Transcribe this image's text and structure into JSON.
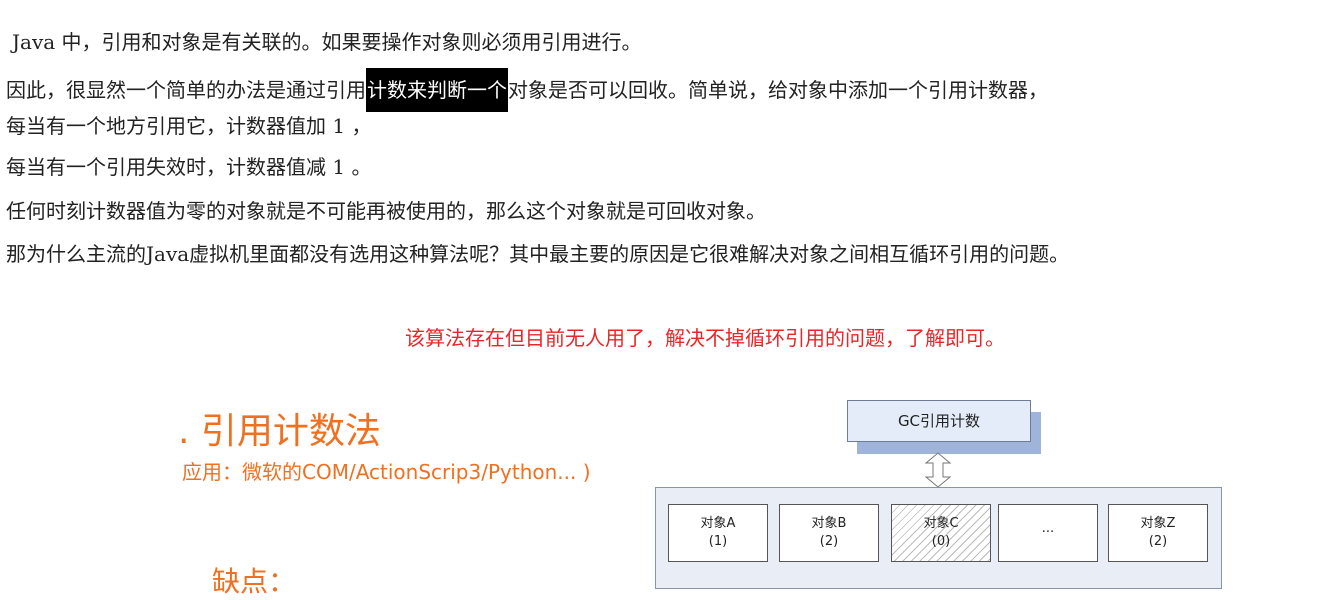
{
  "paragraphs": {
    "l1": "Java 中，引用和对象是有关联的。如果要操作对象则必须用引用进行。",
    "l2a": "因此，很显然一个简单的办法是通过引用",
    "l2_highlight": "计数来判断一个",
    "l2b": "对象是否可以回收。简单说，给对象中添加一个引用计数器，",
    "l3": "每当有一个地方引用它，计数器值加 1 ，",
    "l4": "每当有一个引用失效时，计数器值减 1 。",
    "l5": "任何时刻计数器值为零的对象就是不可能再被使用的，那么这个对象就是可回收对象。",
    "l6": "那为什么主流的Java虚拟机里面都没有选用这种算法呢？其中最主要的原因是它很难解决对象之间相互循环引用的问题。"
  },
  "note": "该算法存在但目前无人用了，解决不掉循环引用的问题，了解即可。",
  "slide": {
    "title": ". 引用计数法",
    "subtitle": "应用：微软的COM/ActionScrip3/Python... )",
    "cut_heading": "缺点："
  },
  "diagram": {
    "gc_label": "GC引用计数",
    "objects": [
      {
        "name": "对象A",
        "count": "(1)"
      },
      {
        "name": "对象B",
        "count": "(2)"
      },
      {
        "name": "对象C",
        "count": "(0)"
      },
      {
        "name": "···",
        "count": ""
      },
      {
        "name": "对象Z",
        "count": "(2)"
      }
    ]
  }
}
